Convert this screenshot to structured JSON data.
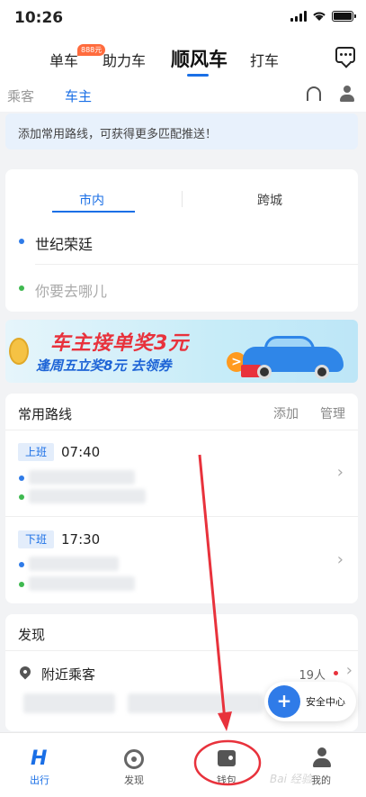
{
  "status_bar": {
    "time": "10:26"
  },
  "top_nav": {
    "items": [
      {
        "label": "单车"
      },
      {
        "label": "助力车",
        "badge": "888元"
      },
      {
        "label": "顺风车",
        "active": true
      },
      {
        "label": "打车"
      }
    ]
  },
  "role_tabs": {
    "passenger": "乘客",
    "driver": "车主"
  },
  "notice": {
    "text": "添加常用路线，可获得更多匹配推送！"
  },
  "trip": {
    "tabs": {
      "city": "市内",
      "intercity": "跨城"
    },
    "from": "世纪荣廷",
    "to_placeholder": "你要去哪儿"
  },
  "banner": {
    "line1": "车主接单奖3元",
    "line2": "逢周五立奖8元 去领券",
    "arrow": ">"
  },
  "routes": {
    "title": "常用路线",
    "add": "添加",
    "manage": "管理",
    "items": [
      {
        "tag": "上班",
        "time": "07:40"
      },
      {
        "tag": "下班",
        "time": "17:30"
      }
    ],
    "chevron": "›"
  },
  "discover": {
    "title": "发现",
    "nearby_label": "附近乘客",
    "nearby_count": "19人",
    "chevron": "›"
  },
  "safety": {
    "label": "安全中心",
    "icon": "+"
  },
  "bottom_tabs": {
    "trip": {
      "label": "出行",
      "icon": "H"
    },
    "discover": {
      "label": "发现"
    },
    "wallet": {
      "label": "钱包"
    },
    "mine": {
      "label": "我的"
    }
  },
  "watermark": "Bai 经验",
  "colors": {
    "accent": "#1a6fe6",
    "annotation": "#e8323c"
  }
}
